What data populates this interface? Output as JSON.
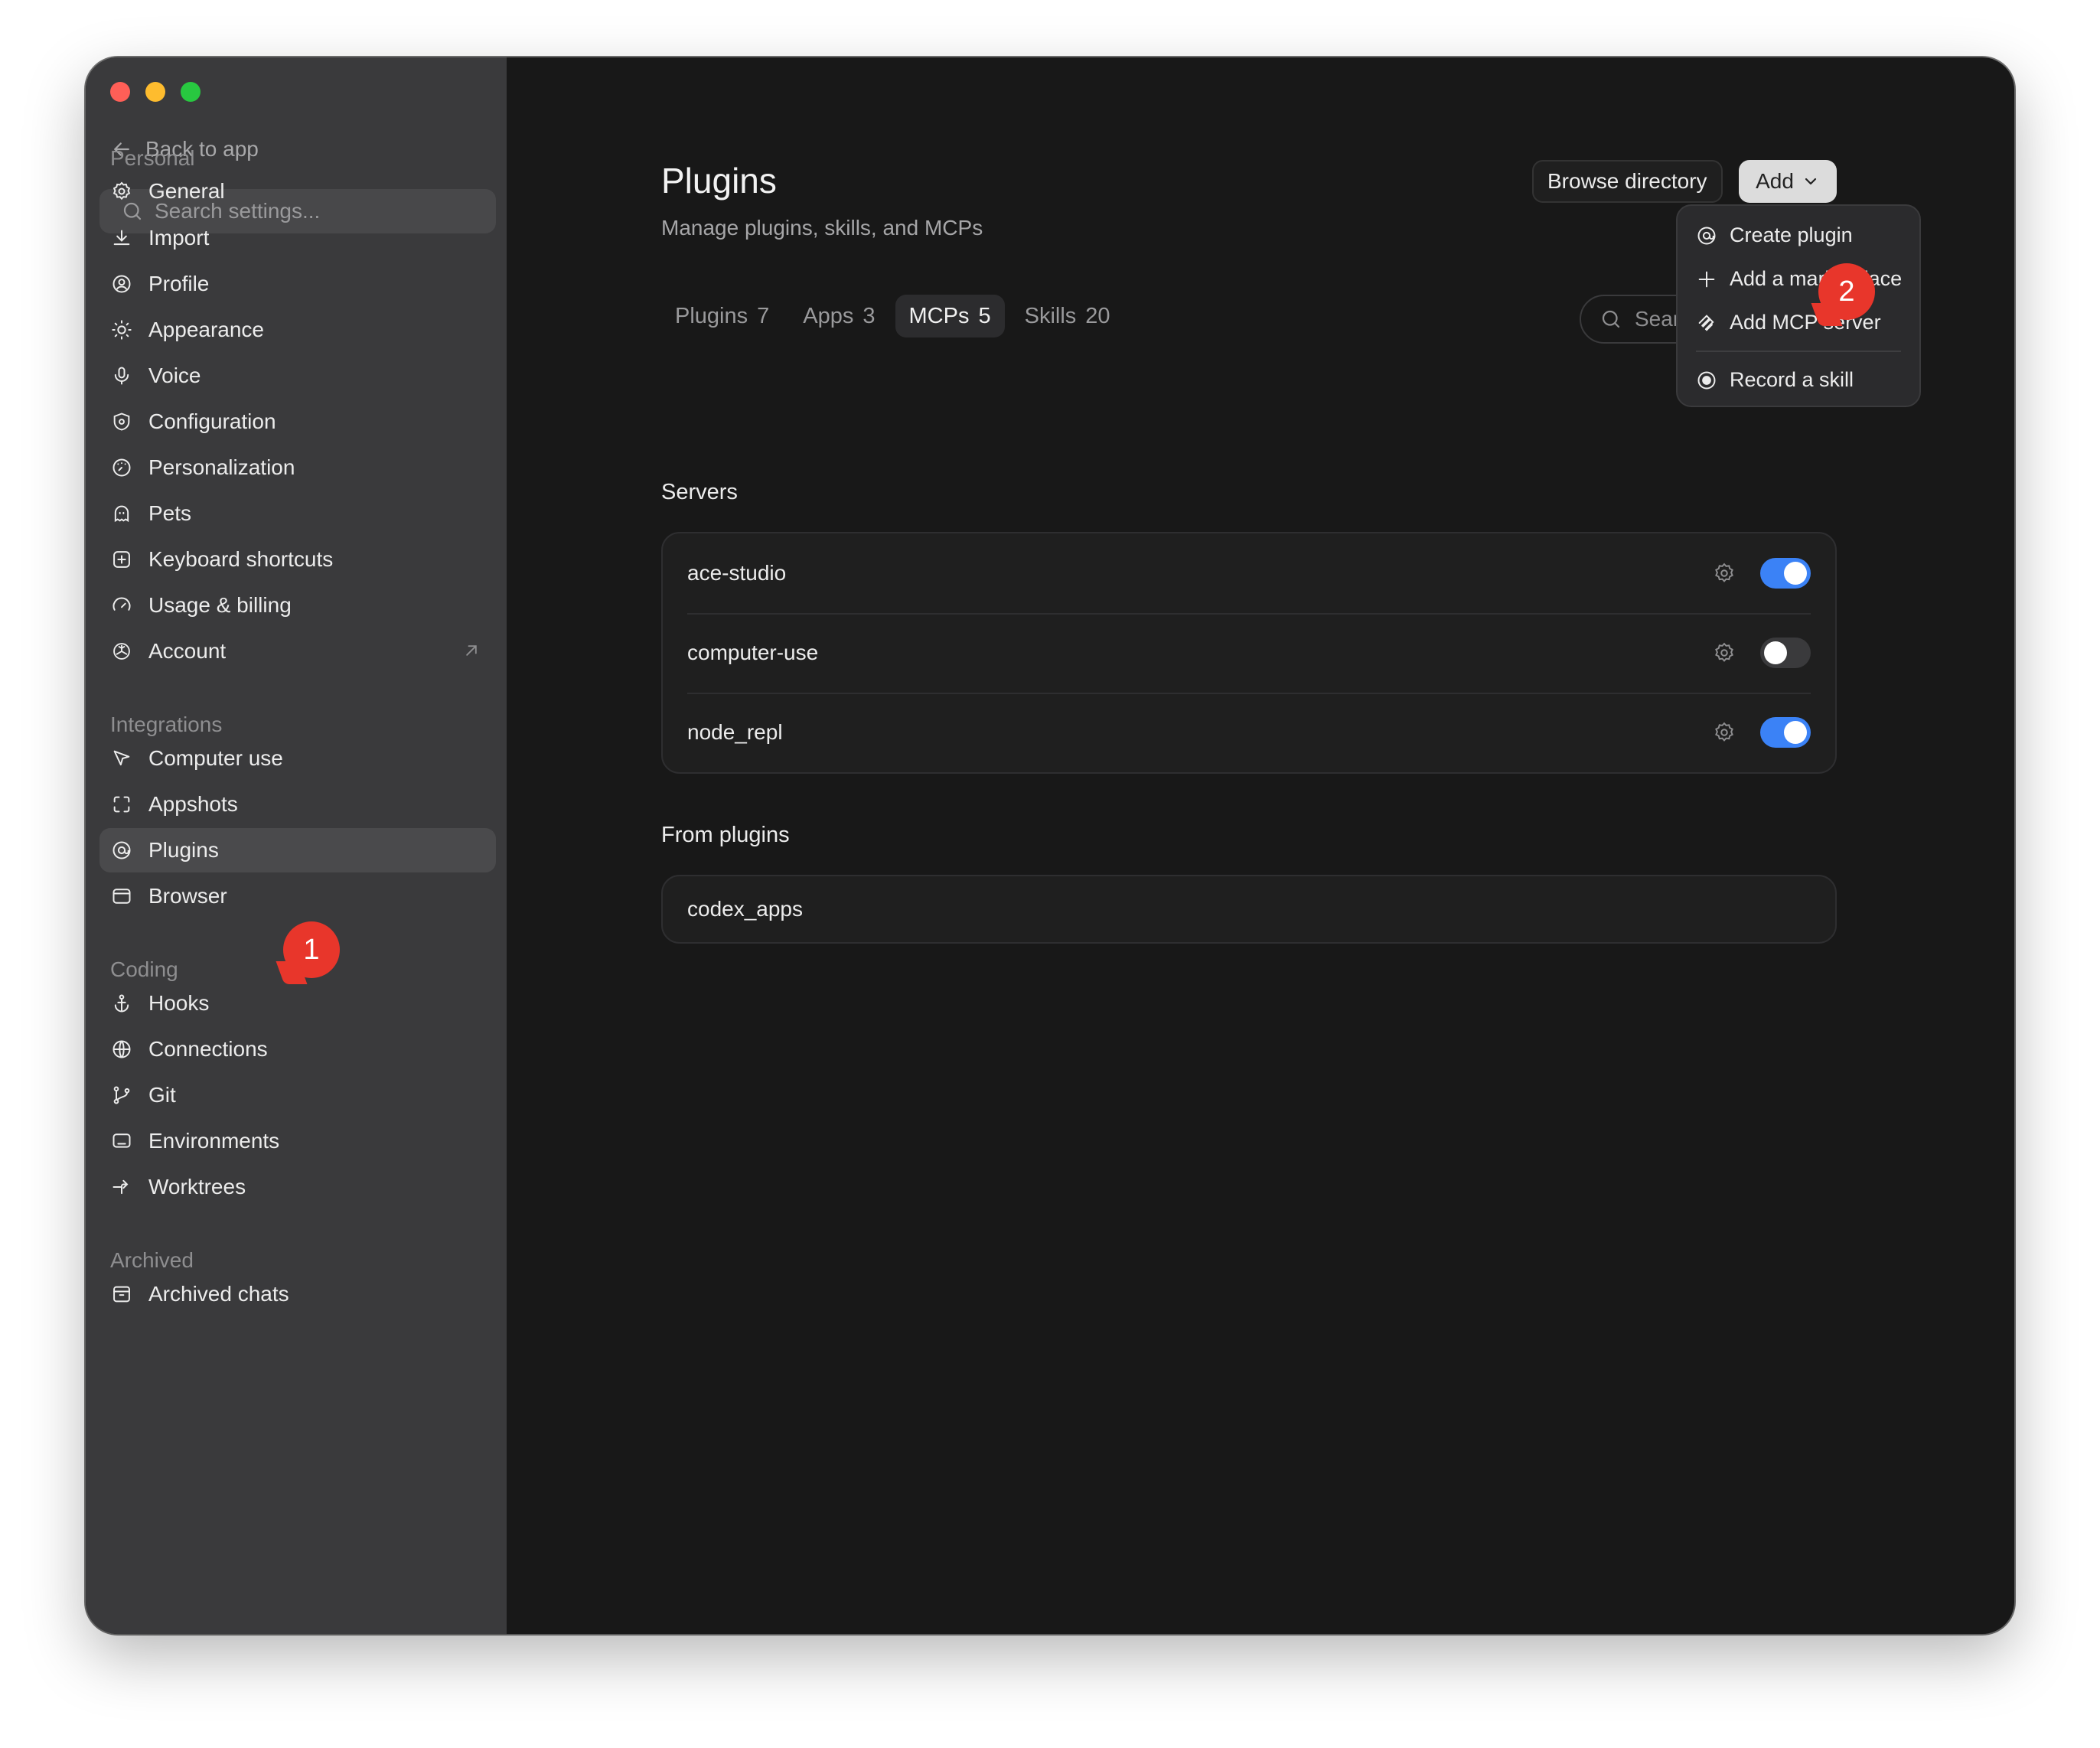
{
  "sidebar": {
    "back_label": "Back to app",
    "search_placeholder": "Search settings...",
    "sections": {
      "personal": "Personal",
      "integrations": "Integrations",
      "coding": "Coding",
      "archived": "Archived"
    },
    "items": {
      "general": "General",
      "import": "Import",
      "profile": "Profile",
      "appearance": "Appearance",
      "voice": "Voice",
      "configuration": "Configuration",
      "personalization": "Personalization",
      "pets": "Pets",
      "keyboard_shortcuts": "Keyboard shortcuts",
      "usage_billing": "Usage & billing",
      "account": "Account",
      "computer_use": "Computer use",
      "appshots": "Appshots",
      "plugins": "Plugins",
      "browser": "Browser",
      "hooks": "Hooks",
      "connections": "Connections",
      "git": "Git",
      "environments": "Environments",
      "worktrees": "Worktrees",
      "archived_chats": "Archived chats"
    },
    "active_item": "Plugins"
  },
  "main": {
    "title": "Plugins",
    "subtitle": "Manage plugins, skills, and MCPs",
    "browse_label": "Browse directory",
    "add_label": "Add",
    "tabs": [
      {
        "label": "Plugins",
        "count": "7"
      },
      {
        "label": "Apps",
        "count": "3"
      },
      {
        "label": "MCPs",
        "count": "5"
      },
      {
        "label": "Skills",
        "count": "20"
      }
    ],
    "active_tab": "MCPs",
    "filter_placeholder": "Sear",
    "servers_heading": "Servers",
    "servers": [
      {
        "name": "ace-studio",
        "enabled": true
      },
      {
        "name": "computer-use",
        "enabled": false
      },
      {
        "name": "node_repl",
        "enabled": true
      }
    ],
    "from_plugins_heading": "From plugins",
    "from_plugins": [
      {
        "name": "codex_apps"
      }
    ]
  },
  "add_menu": {
    "items": [
      "Create plugin",
      "Add a marketplace",
      "Add MCP server",
      "Record a skill"
    ]
  },
  "callouts": [
    "1",
    "2"
  ],
  "colors": {
    "toggle_on": "#3b82f6",
    "callout": "#e8362b",
    "sidebar_bg": "#3a3a3c",
    "main_bg": "#181818"
  }
}
